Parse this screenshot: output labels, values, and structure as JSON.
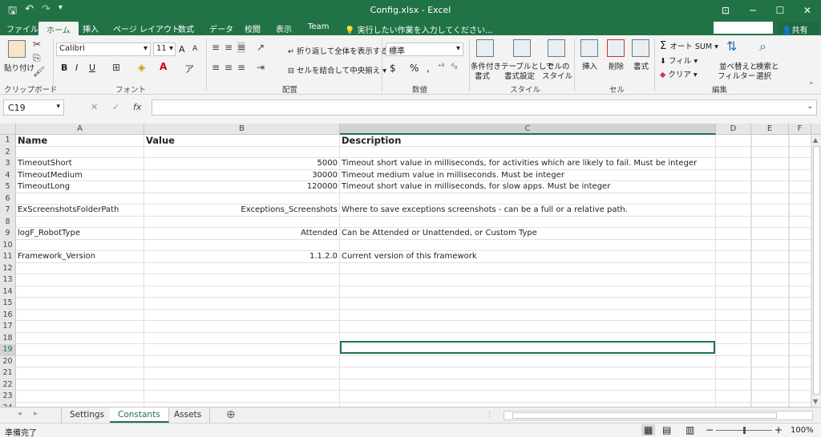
{
  "title_bar": {
    "title": "Config.xlsx - Excel",
    "qa_save": "🖫",
    "qa_undo": "↶",
    "qa_redo": "↷",
    "qa_customize": "▾",
    "win_ribbon": "⊡",
    "win_min": "─",
    "win_max": "☐",
    "win_close": "✕"
  },
  "ribbon_tabs": {
    "file": "ファイル",
    "home": "ホーム",
    "insert": "挿入",
    "page_layout": "ページ レイアウト",
    "formulas": "数式",
    "data": "データ",
    "review": "校閲",
    "view": "表示",
    "team": "Team",
    "tell_me": "実行したい作業を入力してください...",
    "share": "共有"
  },
  "ribbon": {
    "clipboard": {
      "paste": "貼り付け",
      "label": "クリップボード"
    },
    "font": {
      "name": "Calibri",
      "size": "11",
      "bold": "B",
      "italic": "I",
      "underline": "U",
      "grow": "A",
      "shrink": "A",
      "label": "フォント"
    },
    "alignment": {
      "wrap": "折り返して全体を表示する",
      "merge": "セルを結合して中央揃え",
      "label": "配置"
    },
    "number": {
      "format": "標準",
      "currency": "$",
      "percent": "%",
      "comma": ",",
      "label": "数値"
    },
    "styles": {
      "conditional": "条件付き",
      "conditional2": "書式",
      "table": "テーブルとして",
      "table2": "書式設定",
      "cell": "セルの",
      "cell2": "スタイル",
      "label": "スタイル"
    },
    "cells": {
      "insert": "挿入",
      "delete": "削除",
      "format": "書式",
      "label": "セル"
    },
    "editing": {
      "autosum": "オート SUM",
      "fill": "フィル",
      "clear": "クリア",
      "sort": "並べ替えと",
      "sort2": "フィルター",
      "find": "検索と",
      "find2": "選択",
      "label": "編集"
    }
  },
  "formula_bar": {
    "name_box": "C19",
    "cancel": "✕",
    "enter": "✓",
    "fx": "fx",
    "value": ""
  },
  "columns": [
    "A",
    "B",
    "C",
    "D",
    "E",
    "F"
  ],
  "rows": [
    {
      "n": "1",
      "a": "Name",
      "b": "Value",
      "c": "Description",
      "hdr": true
    },
    {
      "n": "2",
      "a": "",
      "b": "",
      "c": ""
    },
    {
      "n": "3",
      "a": "TimeoutShort",
      "b": "5000",
      "c": "Timeout short value in milliseconds, for activities which are likely to fail. Must be integer"
    },
    {
      "n": "4",
      "a": "TimeoutMedium",
      "b": "30000",
      "c": "Timeout medium value in milliseconds. Must be integer"
    },
    {
      "n": "5",
      "a": "TimeoutLong",
      "b": "120000",
      "c": "Timeout short value in milliseconds, for slow apps. Must be integer"
    },
    {
      "n": "6",
      "a": "",
      "b": "",
      "c": ""
    },
    {
      "n": "7",
      "a": "ExScreenshotsFolderPath",
      "b": "Exceptions_Screenshots",
      "c": "Where to save exceptions screenshots - can be a full or a relative path."
    },
    {
      "n": "8",
      "a": "",
      "b": "",
      "c": ""
    },
    {
      "n": "9",
      "a": "logF_RobotType",
      "b": "Attended",
      "c": "Can be Attended or Unattended, or Custom Type"
    },
    {
      "n": "10",
      "a": "",
      "b": "",
      "c": ""
    },
    {
      "n": "11",
      "a": "Framework_Version",
      "b": "1.1.2.0",
      "c": "Current version of this framework"
    },
    {
      "n": "12",
      "a": "",
      "b": "",
      "c": ""
    },
    {
      "n": "13",
      "a": "",
      "b": "",
      "c": ""
    },
    {
      "n": "14",
      "a": "",
      "b": "",
      "c": ""
    },
    {
      "n": "15",
      "a": "",
      "b": "",
      "c": ""
    },
    {
      "n": "16",
      "a": "",
      "b": "",
      "c": ""
    },
    {
      "n": "17",
      "a": "",
      "b": "",
      "c": ""
    },
    {
      "n": "18",
      "a": "",
      "b": "",
      "c": ""
    },
    {
      "n": "19",
      "a": "",
      "b": "",
      "c": ""
    },
    {
      "n": "20",
      "a": "",
      "b": "",
      "c": ""
    },
    {
      "n": "21",
      "a": "",
      "b": "",
      "c": ""
    },
    {
      "n": "22",
      "a": "",
      "b": "",
      "c": ""
    },
    {
      "n": "23",
      "a": "",
      "b": "",
      "c": ""
    },
    {
      "n": "24",
      "a": "",
      "b": "",
      "c": ""
    }
  ],
  "selected_cell": {
    "col": "C",
    "row": "19"
  },
  "sheets": [
    "Settings",
    "Constants",
    "Assets"
  ],
  "active_sheet": "Constants",
  "add_sheet": "⊕",
  "status": {
    "ready": "準備完了",
    "zoom": "100%",
    "zoom_minus": "−",
    "zoom_plus": "+"
  },
  "colors": {
    "excel_green": "#217346"
  }
}
